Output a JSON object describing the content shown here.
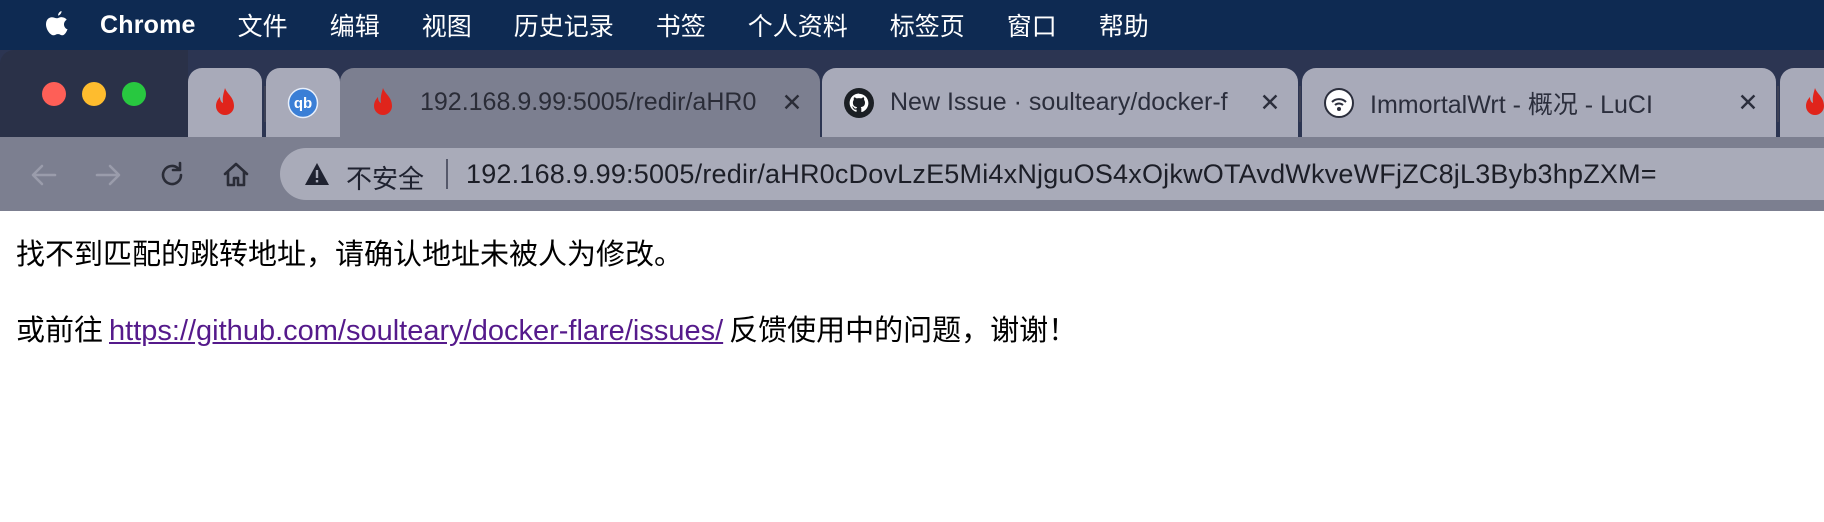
{
  "menubar": {
    "app_name": "Chrome",
    "items": [
      "文件",
      "编辑",
      "视图",
      "历史记录",
      "书签",
      "个人资料",
      "标签页",
      "窗口",
      "帮助"
    ]
  },
  "tabs": [
    {
      "icon": "flame-icon",
      "title": "",
      "pinned": true
    },
    {
      "icon": "qbittorrent-icon",
      "icon_text": "qb",
      "title": "",
      "pinned": true
    },
    {
      "icon": "flame-icon",
      "title": "192.168.9.99:5005/redir/aHR0",
      "active": true,
      "close": "✕"
    },
    {
      "icon": "github-icon",
      "title": "New Issue · soulteary/docker-f",
      "close": "✕"
    },
    {
      "icon": "router-icon",
      "title": "ImmortalWrt - 概况 - LuCI",
      "close": "✕"
    },
    {
      "icon": "flame-icon",
      "title": ""
    }
  ],
  "toolbar": {
    "security_label": "不安全",
    "url": "192.168.9.99:5005/redir/aHR0cDovLzE5Mi4xNjguOS4xOjkwOTAvdWkveWFjZC8jL3Byb3hpZXM="
  },
  "page": {
    "message": "找不到匹配的跳转地址，请确认地址未被人为修改。",
    "prefix": "或前往",
    "link_text": "https://github.com/soulteary/docker-flare/issues/",
    "suffix": "反馈使用中的问题，谢谢！"
  },
  "colors": {
    "menubar_bg": "#0e2a52",
    "tabstrip_bg": "#2c3552",
    "tab_bg": "#a8aab9",
    "active_tab_bg": "#7c7f90",
    "link": "#551a8b",
    "flame": "#e0241b"
  }
}
